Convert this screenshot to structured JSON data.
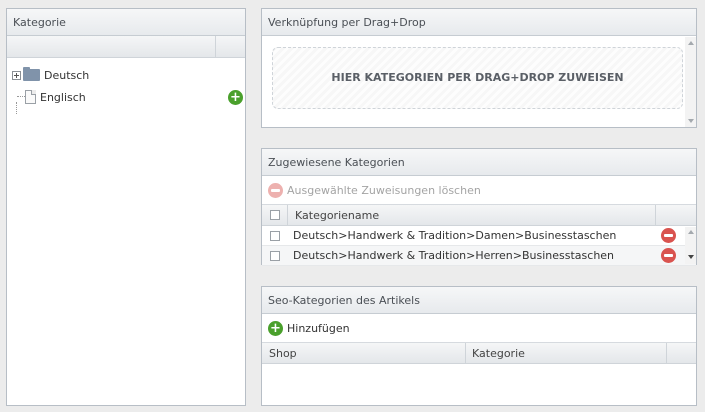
{
  "kategorie_panel": {
    "title": "Kategorie",
    "tree": [
      {
        "label": "Deutsch",
        "type": "folder"
      },
      {
        "label": "Englisch",
        "type": "document"
      }
    ]
  },
  "dragdrop_panel": {
    "title": "Verknüpfung per Drag+Drop",
    "dropzone_text": "HIER KATEGORIEN PER DRAG+DROP ZUWEISEN"
  },
  "assigned_panel": {
    "title": "Zugewiesene Kategorien",
    "delete_selected_label": "Ausgewählte Zuweisungen löschen",
    "column_header": "Kategoriename",
    "rows": [
      {
        "name": "Deutsch>Handwerk & Tradition>Damen>Businesstaschen"
      },
      {
        "name": "Deutsch>Handwerk & Tradition>Herren>Businesstaschen"
      }
    ]
  },
  "seo_panel": {
    "title": "Seo-Kategorien des Artikels",
    "add_label": "Hinzufügen",
    "columns": [
      "Shop",
      "Kategorie"
    ]
  },
  "colors": {
    "add_green": "#4aa02c",
    "delete_red": "#d9534f",
    "header_text": "#4a4f55"
  }
}
